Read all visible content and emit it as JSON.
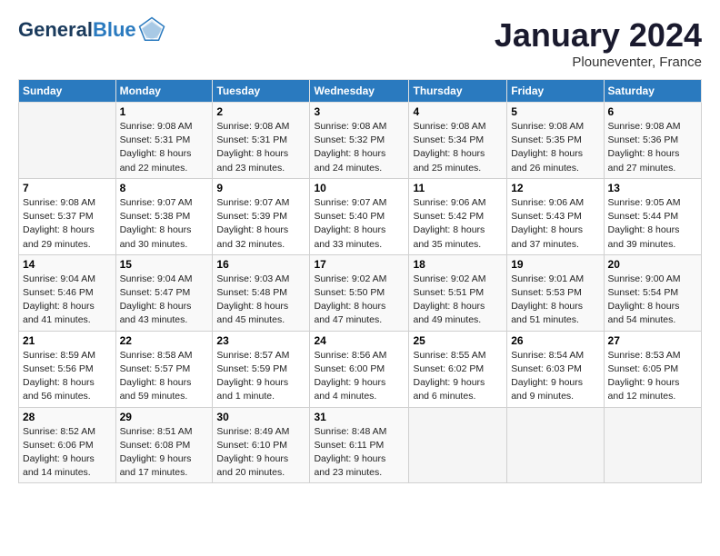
{
  "header": {
    "logo_line1": "General",
    "logo_line2": "Blue",
    "month": "January 2024",
    "location": "Plouneventer, France"
  },
  "days_of_week": [
    "Sunday",
    "Monday",
    "Tuesday",
    "Wednesday",
    "Thursday",
    "Friday",
    "Saturday"
  ],
  "weeks": [
    [
      {
        "day": "",
        "content": ""
      },
      {
        "day": "1",
        "content": "Sunrise: 9:08 AM\nSunset: 5:31 PM\nDaylight: 8 hours\nand 22 minutes."
      },
      {
        "day": "2",
        "content": "Sunrise: 9:08 AM\nSunset: 5:31 PM\nDaylight: 8 hours\nand 23 minutes."
      },
      {
        "day": "3",
        "content": "Sunrise: 9:08 AM\nSunset: 5:32 PM\nDaylight: 8 hours\nand 24 minutes."
      },
      {
        "day": "4",
        "content": "Sunrise: 9:08 AM\nSunset: 5:34 PM\nDaylight: 8 hours\nand 25 minutes."
      },
      {
        "day": "5",
        "content": "Sunrise: 9:08 AM\nSunset: 5:35 PM\nDaylight: 8 hours\nand 26 minutes."
      },
      {
        "day": "6",
        "content": "Sunrise: 9:08 AM\nSunset: 5:36 PM\nDaylight: 8 hours\nand 27 minutes."
      }
    ],
    [
      {
        "day": "7",
        "content": "Sunrise: 9:08 AM\nSunset: 5:37 PM\nDaylight: 8 hours\nand 29 minutes."
      },
      {
        "day": "8",
        "content": "Sunrise: 9:07 AM\nSunset: 5:38 PM\nDaylight: 8 hours\nand 30 minutes."
      },
      {
        "day": "9",
        "content": "Sunrise: 9:07 AM\nSunset: 5:39 PM\nDaylight: 8 hours\nand 32 minutes."
      },
      {
        "day": "10",
        "content": "Sunrise: 9:07 AM\nSunset: 5:40 PM\nDaylight: 8 hours\nand 33 minutes."
      },
      {
        "day": "11",
        "content": "Sunrise: 9:06 AM\nSunset: 5:42 PM\nDaylight: 8 hours\nand 35 minutes."
      },
      {
        "day": "12",
        "content": "Sunrise: 9:06 AM\nSunset: 5:43 PM\nDaylight: 8 hours\nand 37 minutes."
      },
      {
        "day": "13",
        "content": "Sunrise: 9:05 AM\nSunset: 5:44 PM\nDaylight: 8 hours\nand 39 minutes."
      }
    ],
    [
      {
        "day": "14",
        "content": "Sunrise: 9:04 AM\nSunset: 5:46 PM\nDaylight: 8 hours\nand 41 minutes."
      },
      {
        "day": "15",
        "content": "Sunrise: 9:04 AM\nSunset: 5:47 PM\nDaylight: 8 hours\nand 43 minutes."
      },
      {
        "day": "16",
        "content": "Sunrise: 9:03 AM\nSunset: 5:48 PM\nDaylight: 8 hours\nand 45 minutes."
      },
      {
        "day": "17",
        "content": "Sunrise: 9:02 AM\nSunset: 5:50 PM\nDaylight: 8 hours\nand 47 minutes."
      },
      {
        "day": "18",
        "content": "Sunrise: 9:02 AM\nSunset: 5:51 PM\nDaylight: 8 hours\nand 49 minutes."
      },
      {
        "day": "19",
        "content": "Sunrise: 9:01 AM\nSunset: 5:53 PM\nDaylight: 8 hours\nand 51 minutes."
      },
      {
        "day": "20",
        "content": "Sunrise: 9:00 AM\nSunset: 5:54 PM\nDaylight: 8 hours\nand 54 minutes."
      }
    ],
    [
      {
        "day": "21",
        "content": "Sunrise: 8:59 AM\nSunset: 5:56 PM\nDaylight: 8 hours\nand 56 minutes."
      },
      {
        "day": "22",
        "content": "Sunrise: 8:58 AM\nSunset: 5:57 PM\nDaylight: 8 hours\nand 59 minutes."
      },
      {
        "day": "23",
        "content": "Sunrise: 8:57 AM\nSunset: 5:59 PM\nDaylight: 9 hours\nand 1 minute."
      },
      {
        "day": "24",
        "content": "Sunrise: 8:56 AM\nSunset: 6:00 PM\nDaylight: 9 hours\nand 4 minutes."
      },
      {
        "day": "25",
        "content": "Sunrise: 8:55 AM\nSunset: 6:02 PM\nDaylight: 9 hours\nand 6 minutes."
      },
      {
        "day": "26",
        "content": "Sunrise: 8:54 AM\nSunset: 6:03 PM\nDaylight: 9 hours\nand 9 minutes."
      },
      {
        "day": "27",
        "content": "Sunrise: 8:53 AM\nSunset: 6:05 PM\nDaylight: 9 hours\nand 12 minutes."
      }
    ],
    [
      {
        "day": "28",
        "content": "Sunrise: 8:52 AM\nSunset: 6:06 PM\nDaylight: 9 hours\nand 14 minutes."
      },
      {
        "day": "29",
        "content": "Sunrise: 8:51 AM\nSunset: 6:08 PM\nDaylight: 9 hours\nand 17 minutes."
      },
      {
        "day": "30",
        "content": "Sunrise: 8:49 AM\nSunset: 6:10 PM\nDaylight: 9 hours\nand 20 minutes."
      },
      {
        "day": "31",
        "content": "Sunrise: 8:48 AM\nSunset: 6:11 PM\nDaylight: 9 hours\nand 23 minutes."
      },
      {
        "day": "",
        "content": ""
      },
      {
        "day": "",
        "content": ""
      },
      {
        "day": "",
        "content": ""
      }
    ]
  ]
}
